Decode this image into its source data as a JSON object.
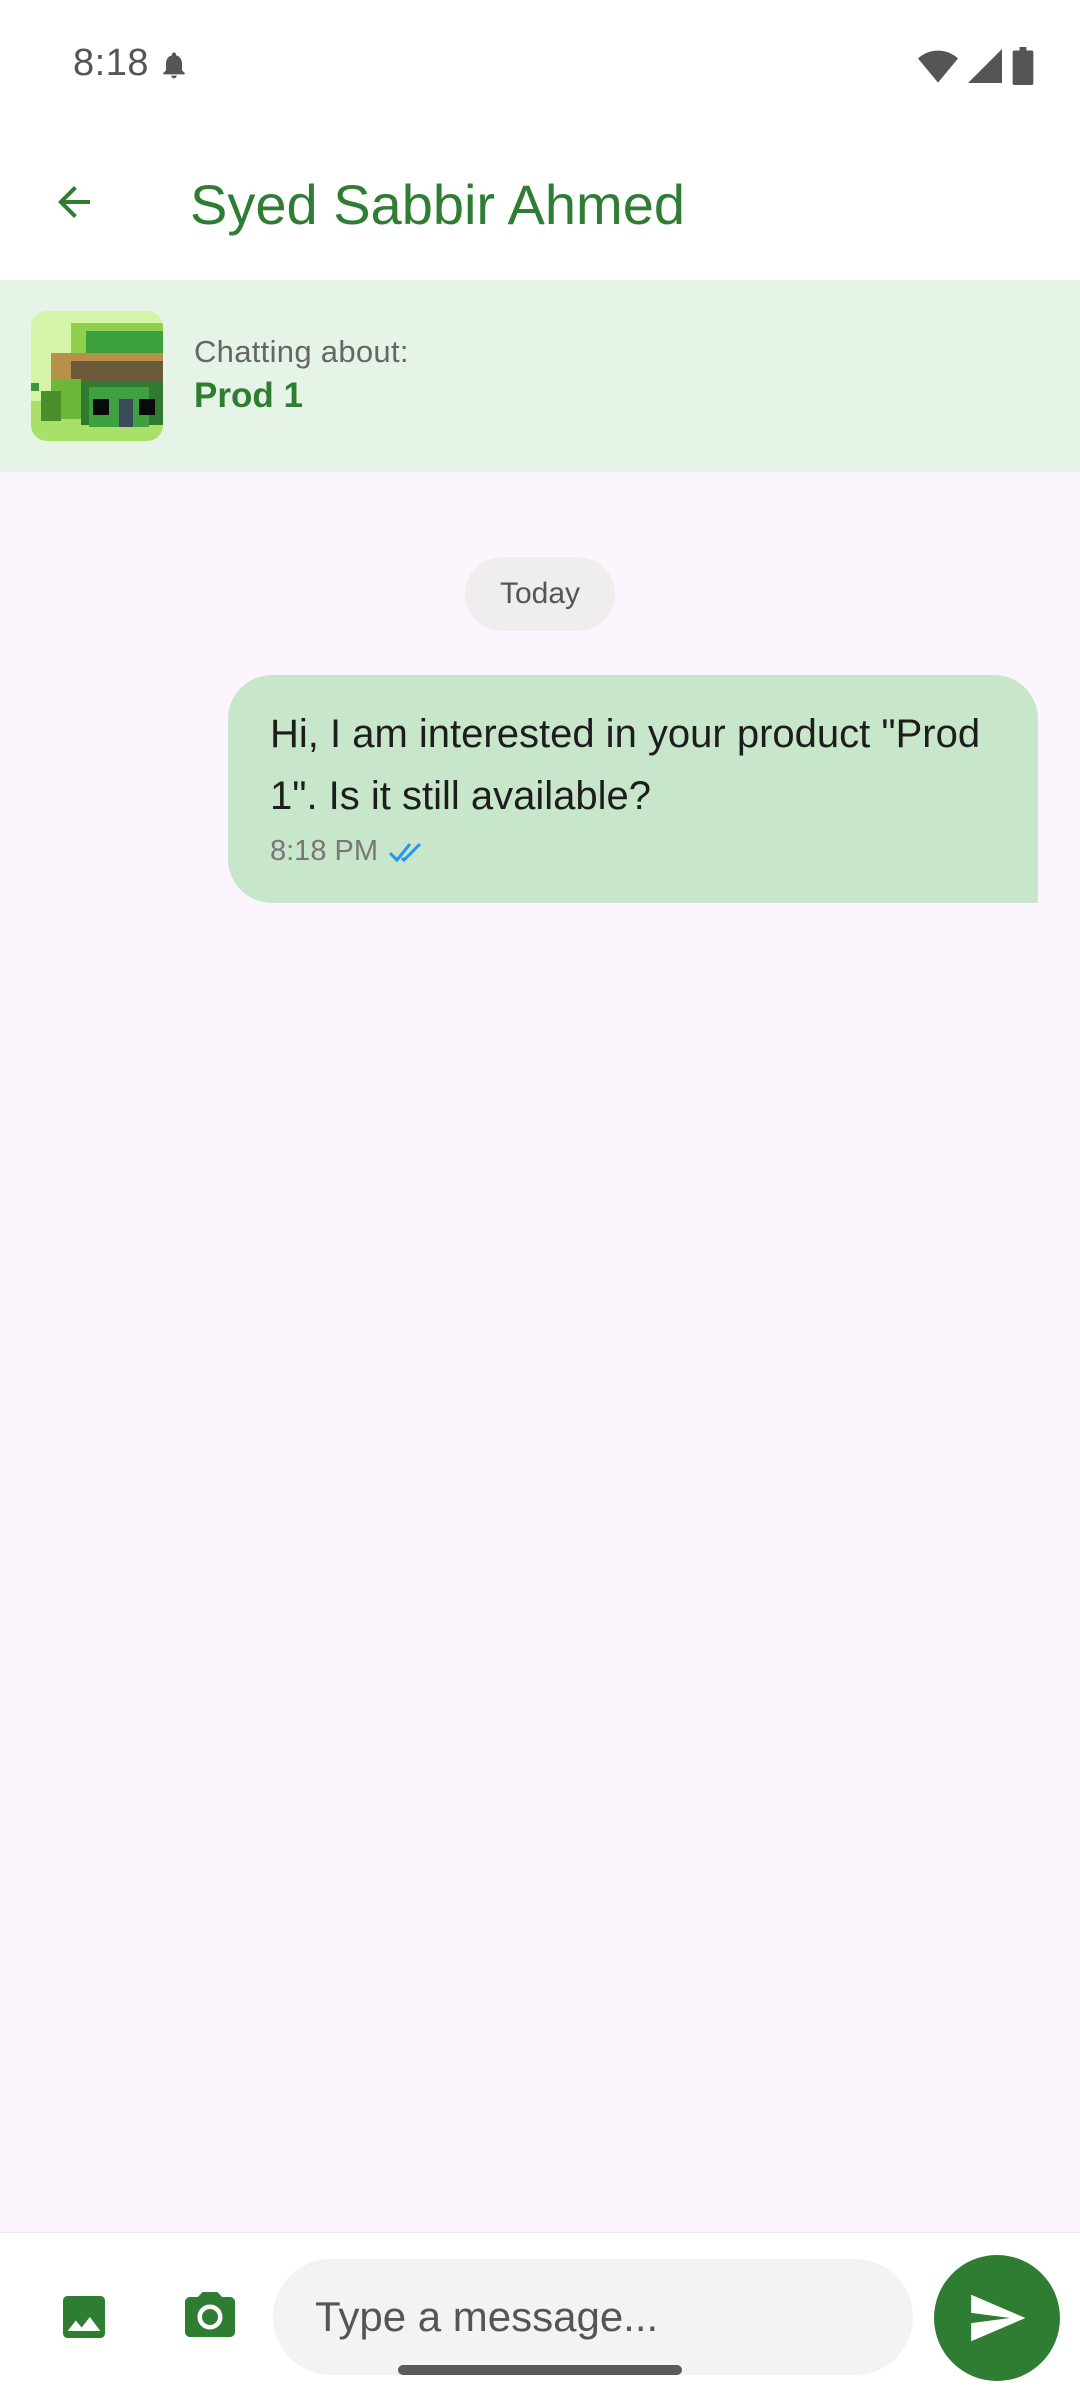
{
  "status_bar": {
    "time": "8:18",
    "icons": [
      "notification-bell-icon",
      "wifi-icon",
      "cellular-signal-icon",
      "battery-icon"
    ]
  },
  "app_bar": {
    "back_icon": "arrow-back-icon",
    "title": "Syed Sabbir Ahmed"
  },
  "product_banner": {
    "label": "Chatting about:",
    "product_name": "Prod 1"
  },
  "conversation": {
    "date_divider": "Today",
    "messages": [
      {
        "text": "Hi, I am interested in your product \"Prod 1\". Is it still available?",
        "time": "8:18 PM",
        "status_icon": "double-check-icon",
        "outgoing": true
      }
    ]
  },
  "input_bar": {
    "gallery_icon": "image-icon",
    "camera_icon": "camera-icon",
    "placeholder": "Type a message...",
    "value": "",
    "send_icon": "send-icon"
  },
  "colors": {
    "primary": "#2e7d32",
    "banner_bg": "#e5f4e6",
    "bubble_bg": "#c8e6c9",
    "chat_bg": "#fcf5fd",
    "read_tick": "#2196f3"
  }
}
